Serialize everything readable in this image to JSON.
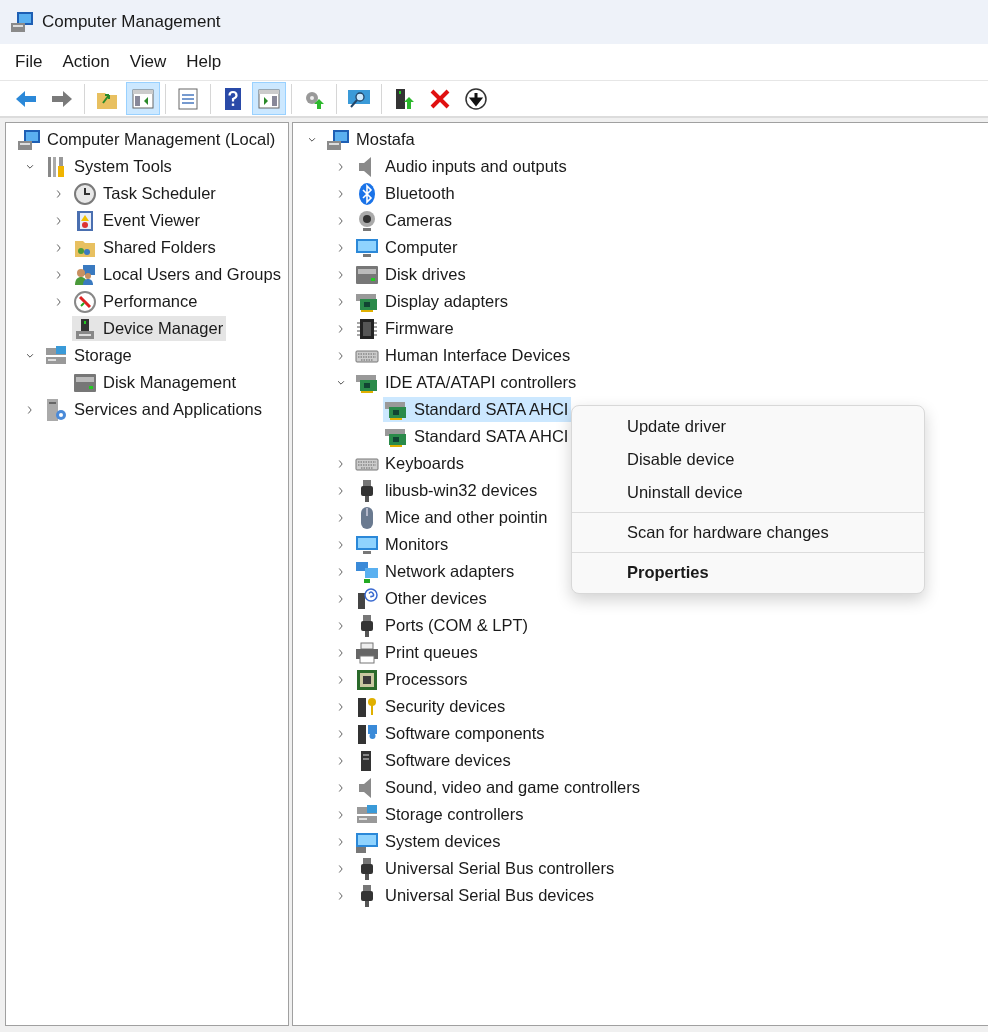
{
  "window": {
    "title": "Computer Management"
  },
  "menu_bar": [
    "File",
    "Action",
    "View",
    "Help"
  ],
  "toolbar": {
    "groups": [
      {
        "buttons": [
          {
            "pressed": false
          },
          {
            "pressed": false
          }
        ]
      },
      {
        "buttons": [
          {
            "pressed": false
          },
          {
            "pressed": true
          }
        ]
      },
      {
        "buttons": [
          {
            "pressed": false
          }
        ]
      },
      {
        "buttons": [
          {
            "pressed": false
          },
          {
            "pressed": true
          }
        ]
      },
      {
        "buttons": [
          {
            "pressed": false
          }
        ]
      },
      {
        "buttons": [
          {
            "pressed": false
          }
        ]
      },
      {
        "buttons": [
          {
            "pressed": false
          },
          {
            "pressed": false
          },
          {
            "pressed": false
          }
        ]
      }
    ]
  },
  "left_tree": [
    {
      "label": "Computer Management (Local)",
      "selected": false,
      "children": [
        {
          "label": "System Tools",
          "expanded": true,
          "selected": false,
          "children": [
            {
              "label": "Task Scheduler",
              "expanded": false,
              "selected": false
            },
            {
              "label": "Event Viewer",
              "expanded": false,
              "selected": false
            },
            {
              "label": "Shared Folders",
              "expanded": false,
              "selected": false
            },
            {
              "label": "Local Users and Groups",
              "expanded": false,
              "selected": false
            },
            {
              "label": "Performance",
              "expanded": false,
              "selected": false
            },
            {
              "label": "Device Manager",
              "selected": true
            }
          ]
        },
        {
          "label": "Storage",
          "expanded": true,
          "selected": false,
          "children": [
            {
              "label": "Disk Management",
              "selected": false
            }
          ]
        },
        {
          "label": "Services and Applications",
          "expanded": false,
          "selected": false
        }
      ]
    }
  ],
  "device_tree": [
    {
      "label": "Mostafa",
      "expanded": true,
      "selected": false,
      "children": [
        {
          "label": "Audio inputs and outputs",
          "expanded": false,
          "selected": false
        },
        {
          "label": "Bluetooth",
          "expanded": false,
          "selected": false
        },
        {
          "label": "Cameras",
          "expanded": false,
          "selected": false
        },
        {
          "label": "Computer",
          "expanded": false,
          "selected": false
        },
        {
          "label": "Disk drives",
          "expanded": false,
          "selected": false
        },
        {
          "label": "Display adapters",
          "expanded": false,
          "selected": false
        },
        {
          "label": "Firmware",
          "expanded": false,
          "selected": false
        },
        {
          "label": "Human Interface Devices",
          "expanded": false,
          "selected": false
        },
        {
          "label": "IDE ATA/ATAPI controllers",
          "expanded": true,
          "selected": false,
          "children": [
            {
              "label": "Standard SATA AHCI",
              "selected": true
            },
            {
              "label": "Standard SATA AHCI",
              "selected": false
            }
          ]
        },
        {
          "label": "Keyboards",
          "expanded": false,
          "selected": false
        },
        {
          "label": "libusb-win32 devices",
          "expanded": false,
          "selected": false
        },
        {
          "label": "Mice and other pointin",
          "expanded": false,
          "selected": false
        },
        {
          "label": "Monitors",
          "expanded": false,
          "selected": false
        },
        {
          "label": "Network adapters",
          "expanded": false,
          "selected": false
        },
        {
          "label": "Other devices",
          "expanded": false,
          "selected": false
        },
        {
          "label": "Ports (COM & LPT)",
          "expanded": false,
          "selected": false
        },
        {
          "label": "Print queues",
          "expanded": false,
          "selected": false
        },
        {
          "label": "Processors",
          "expanded": false,
          "selected": false
        },
        {
          "label": "Security devices",
          "expanded": false,
          "selected": false
        },
        {
          "label": "Software components",
          "expanded": false,
          "selected": false
        },
        {
          "label": "Software devices",
          "expanded": false,
          "selected": false
        },
        {
          "label": "Sound, video and game controllers",
          "expanded": false,
          "selected": false
        },
        {
          "label": "Storage controllers",
          "expanded": false,
          "selected": false
        },
        {
          "label": "System devices",
          "expanded": false,
          "selected": false
        },
        {
          "label": "Universal Serial Bus controllers",
          "expanded": false,
          "selected": false
        },
        {
          "label": "Universal Serial Bus devices",
          "expanded": false,
          "selected": false
        }
      ]
    }
  ],
  "context_menu": {
    "groups": [
      {
        "items": [
          {
            "label": "Update driver",
            "default": false
          },
          {
            "label": "Disable device",
            "default": false
          },
          {
            "label": "Uninstall device",
            "default": false
          }
        ]
      },
      {
        "items": [
          {
            "label": "Scan for hardware changes",
            "default": false
          }
        ]
      },
      {
        "items": [
          {
            "label": "Properties",
            "default": true
          }
        ]
      }
    ]
  }
}
